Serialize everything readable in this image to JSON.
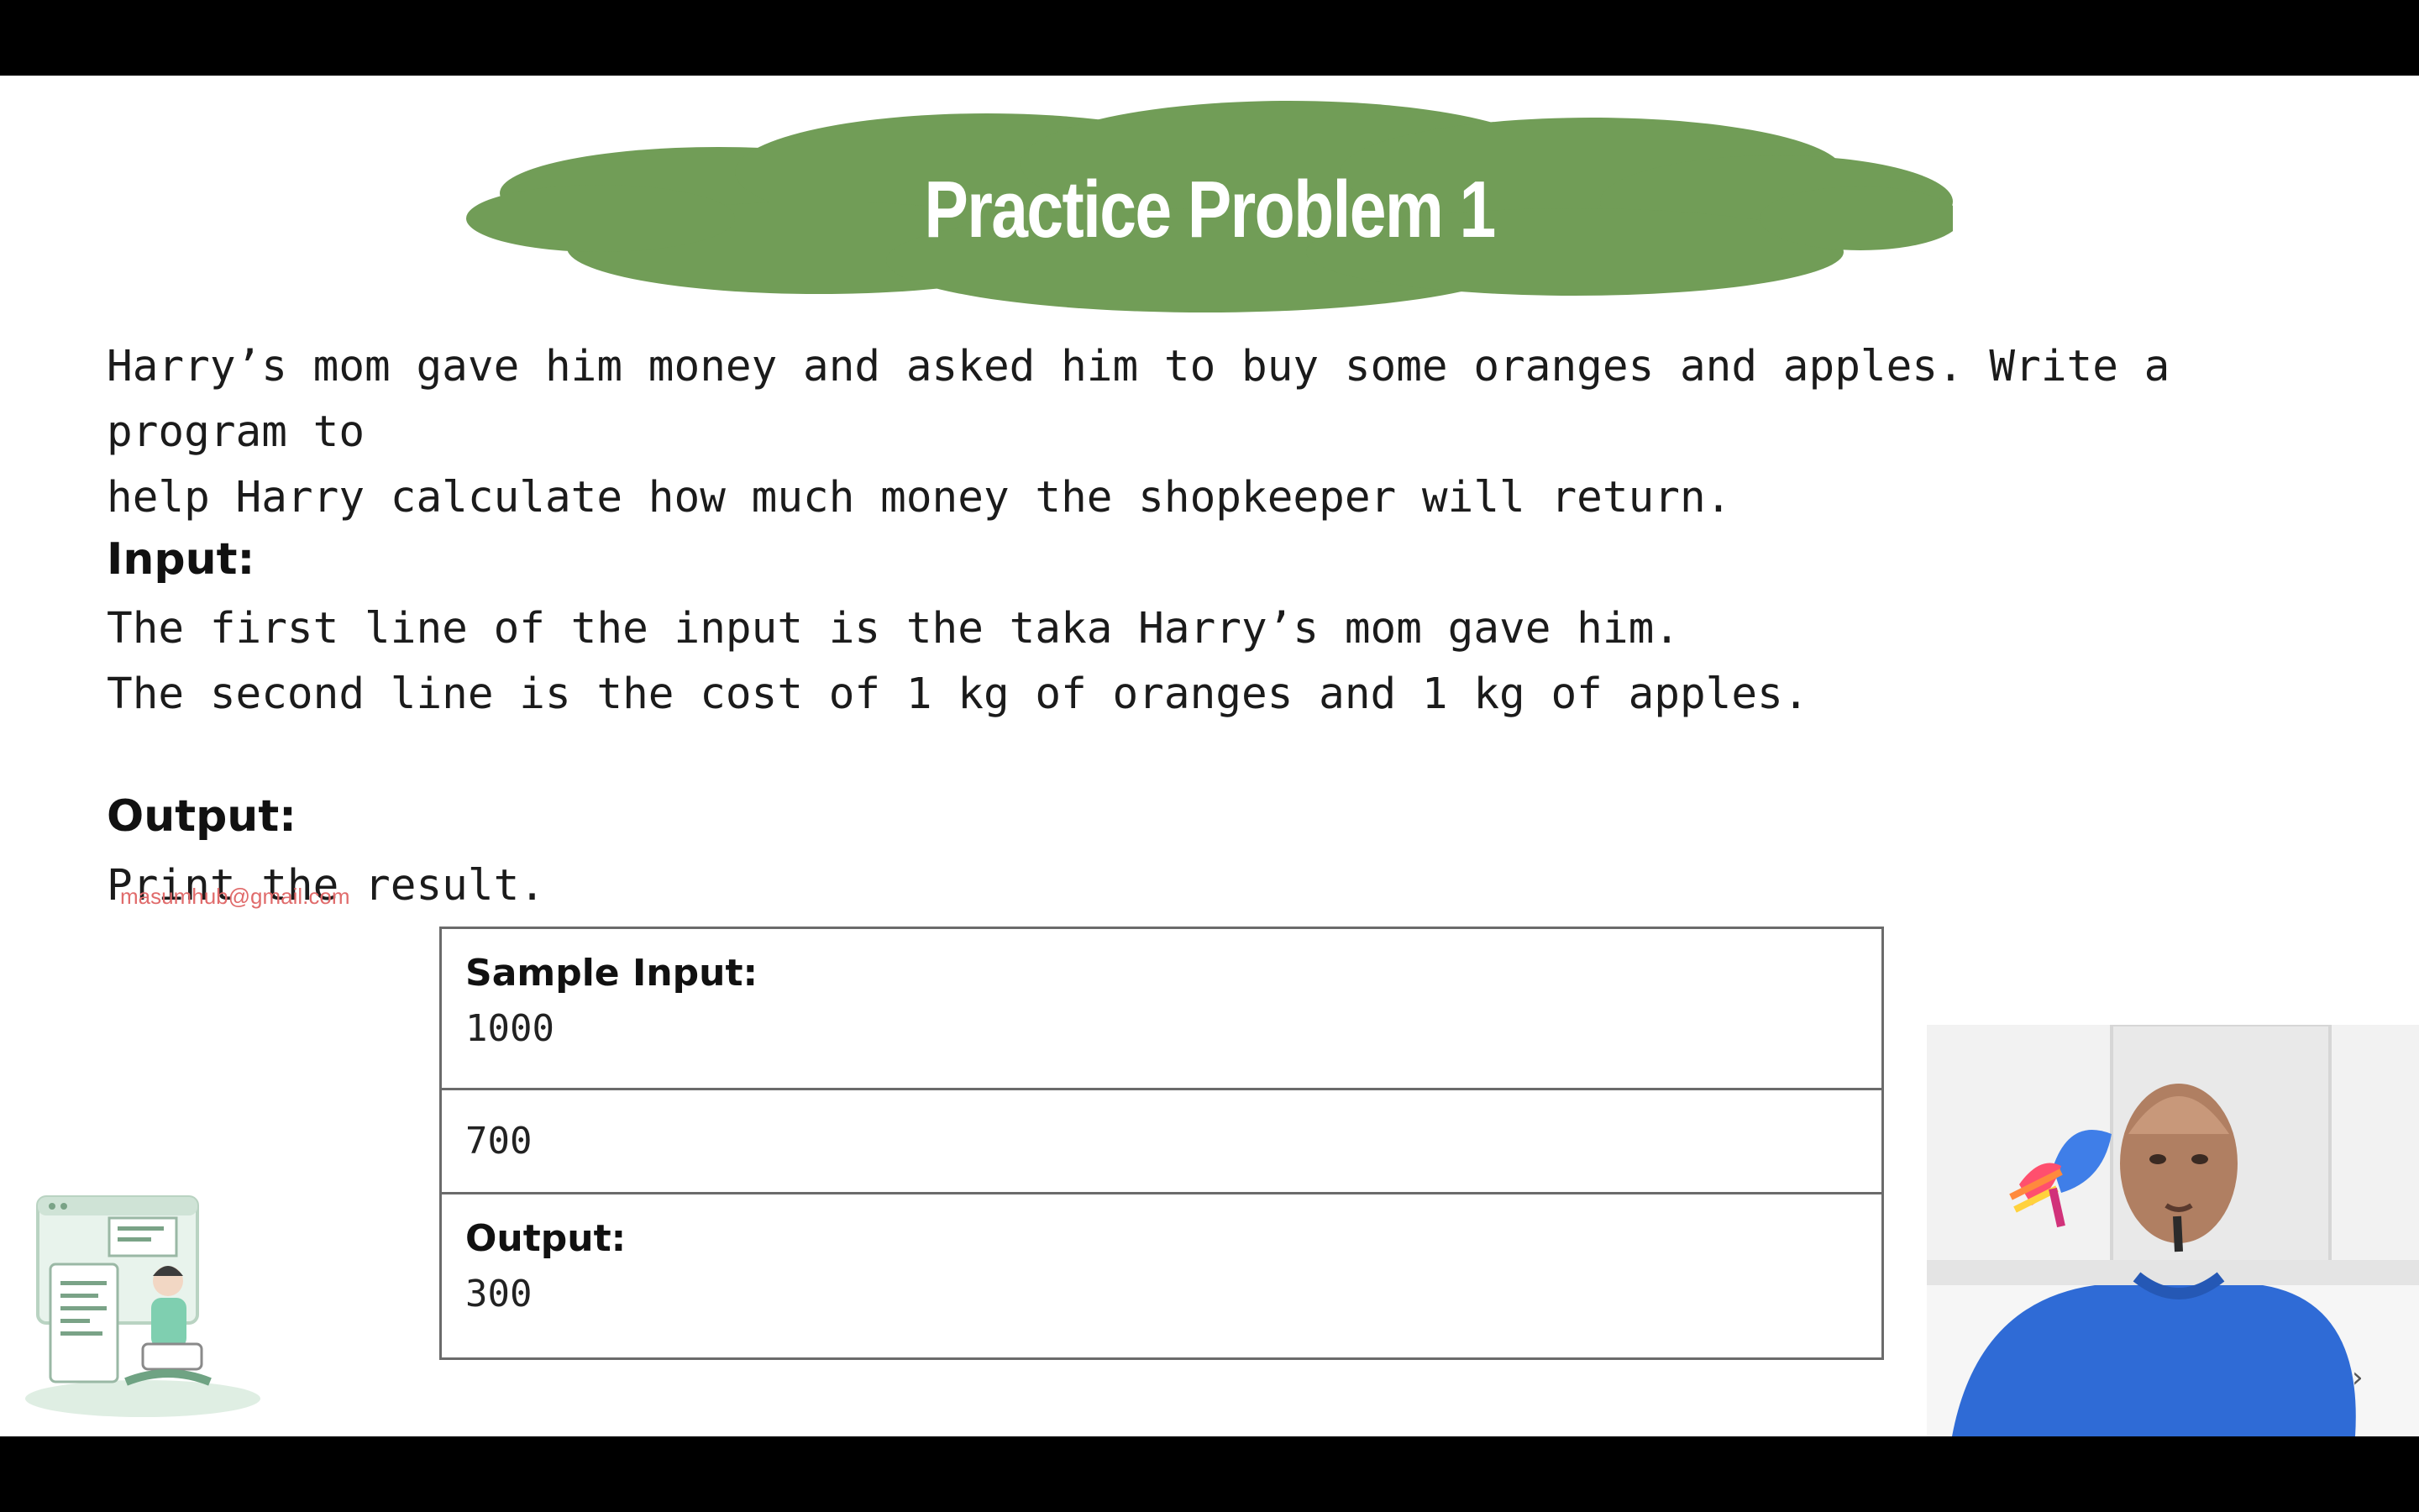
{
  "slide": {
    "title": "Practice Problem 1",
    "intro_line1": "Harry’s mom gave him money and asked him to buy some oranges and apples. Write a program to",
    "intro_line2": "help Harry calculate how much money the shopkeeper will return.",
    "input_heading": "Input:",
    "input_line1": "The first line of the input is the taka Harry’s mom gave him.",
    "input_line2": "The second line is the cost of 1 kg of oranges and 1 kg of apples.",
    "output_heading": "Output:",
    "output_line": "Print the result.",
    "watermark": "masumhub@gmail.com"
  },
  "sample": {
    "input_label": "Sample Input:",
    "input_value1": "1000",
    "input_value2": "700",
    "output_label": "Output:",
    "output_value": "300"
  },
  "colors": {
    "cloud": "#719d57",
    "text": "#1b1b1b",
    "border": "#6b6b6b",
    "webcam_shirt": "#2f6bd6"
  },
  "icons": {
    "title_badge": "cloud-shape",
    "corner_art": "developer-illustration",
    "brand_logo": "feather-logo-icon",
    "nav": "chevron-right-icon"
  },
  "nav": {
    "chevron": "›"
  }
}
